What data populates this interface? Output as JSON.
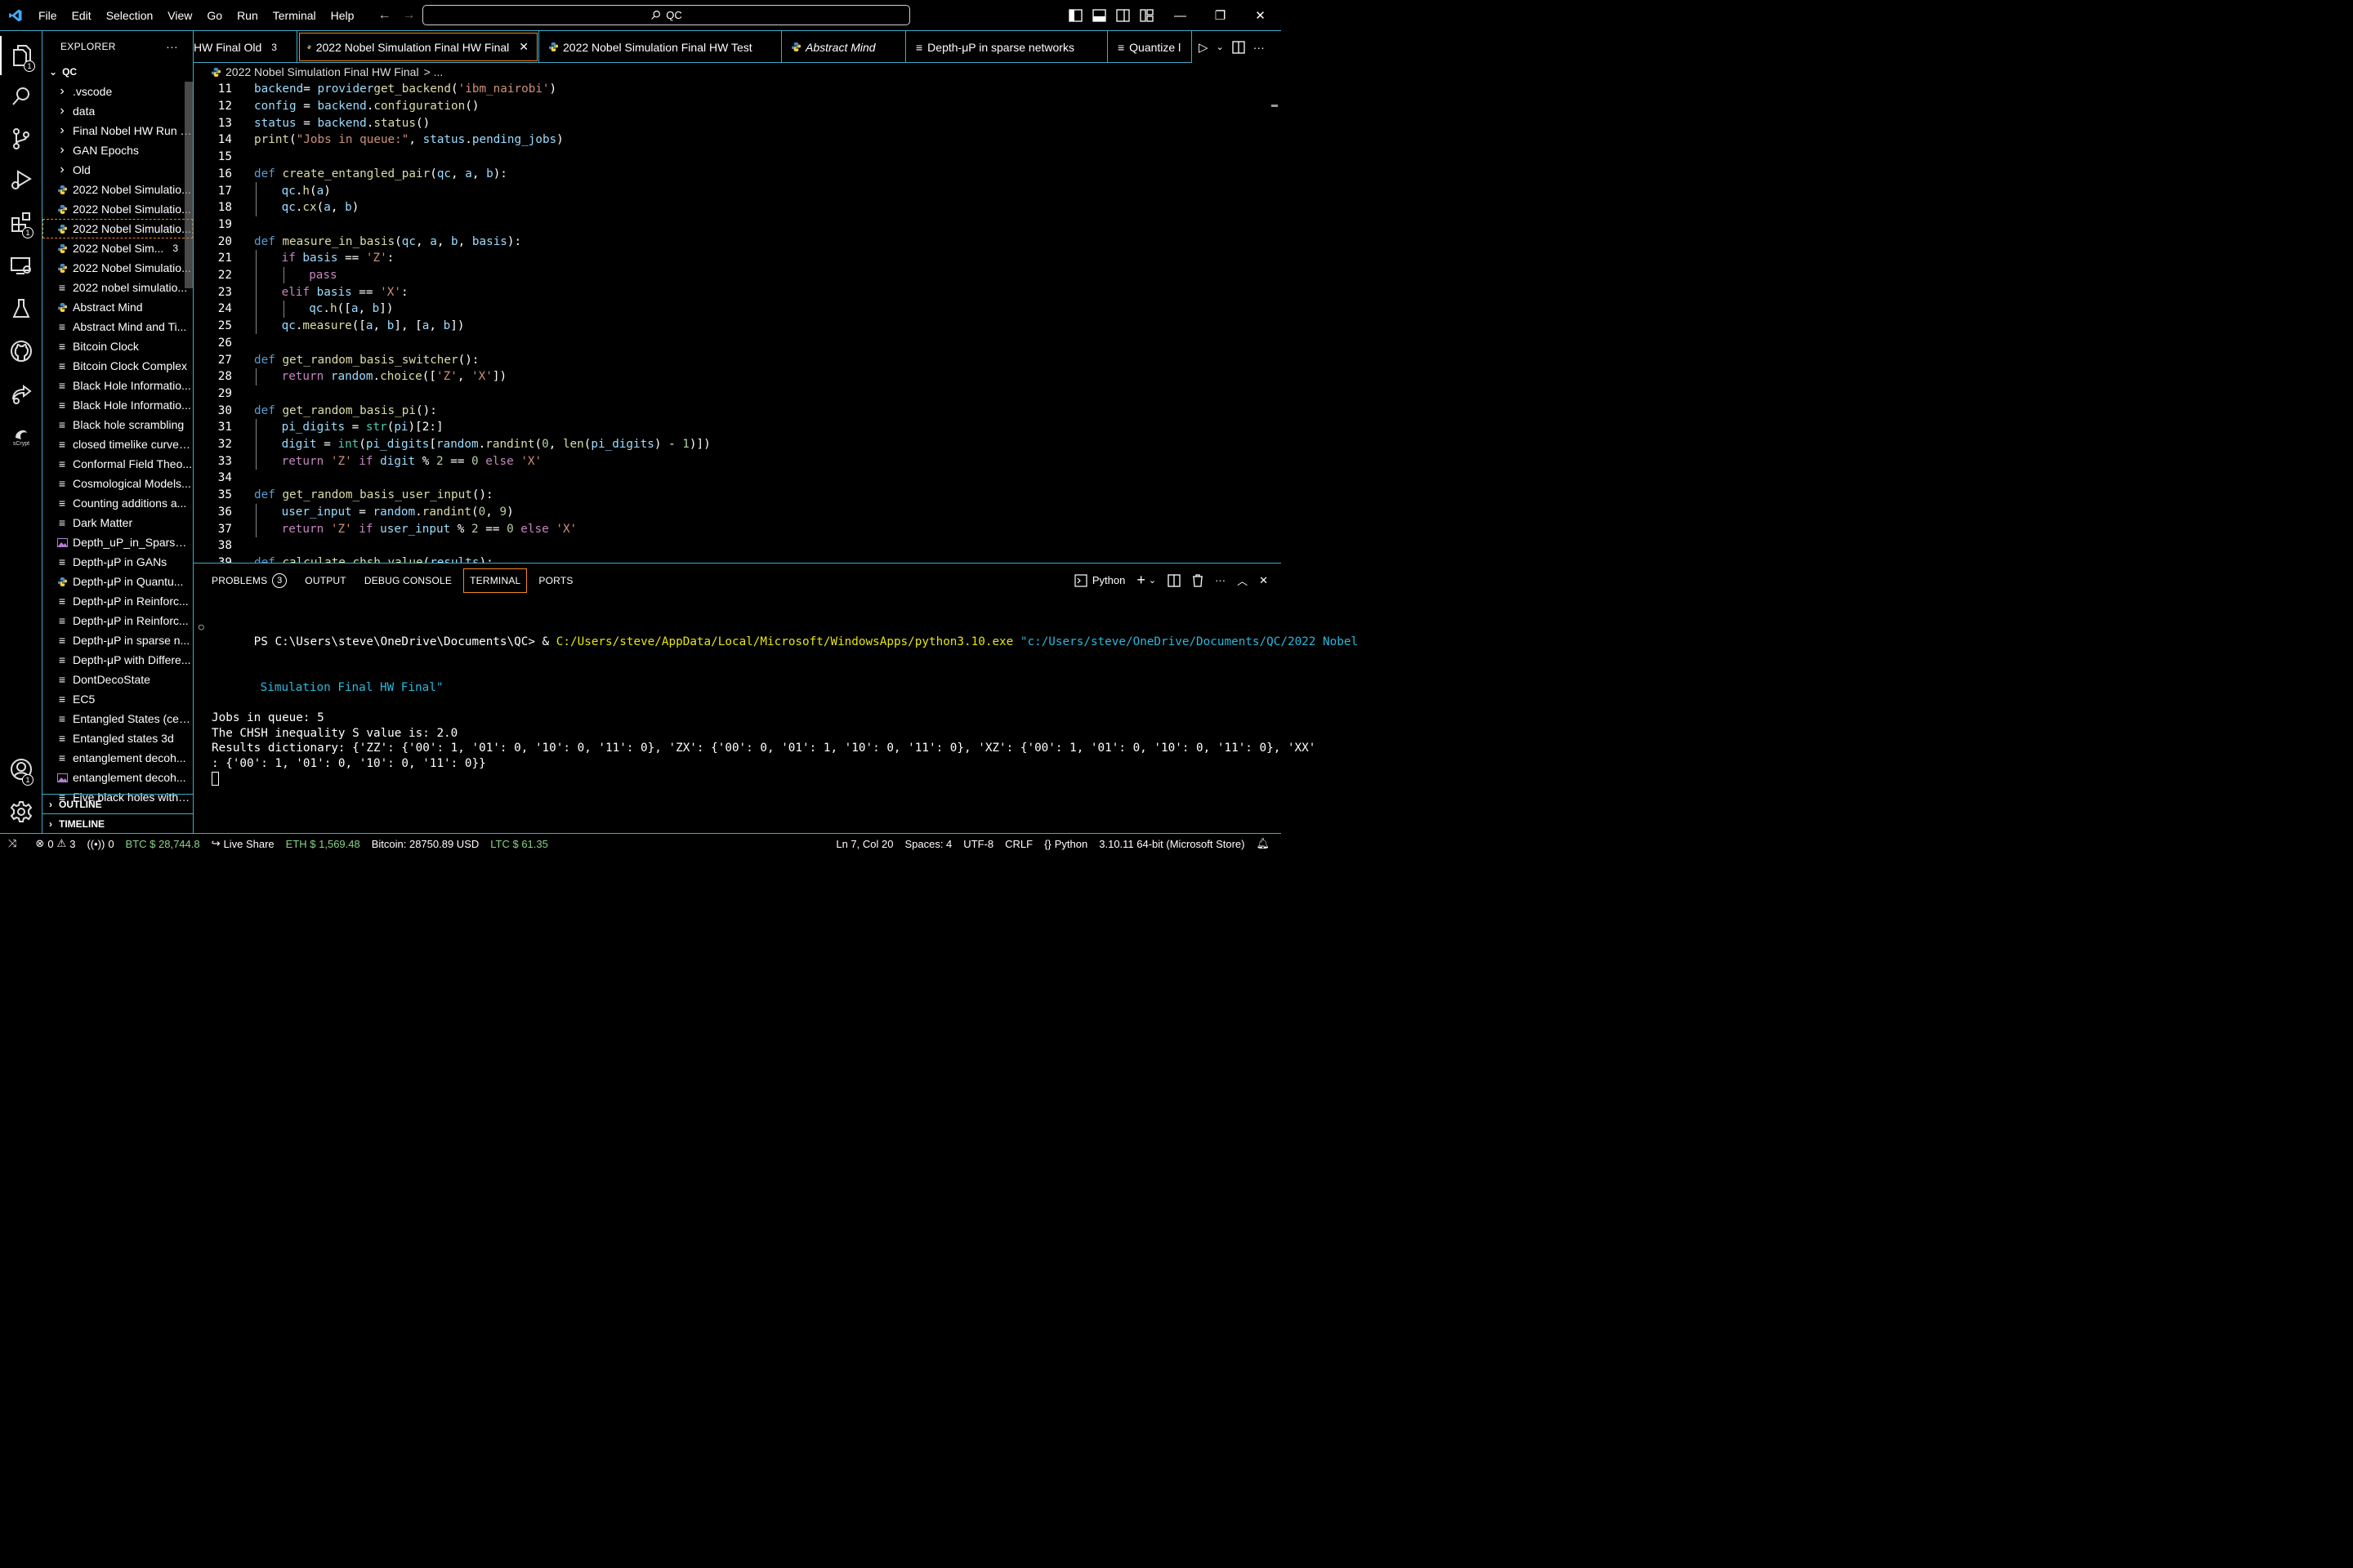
{
  "titlebar": {
    "menu": [
      "File",
      "Edit",
      "Selection",
      "View",
      "Go",
      "Run",
      "Terminal",
      "Help"
    ],
    "search": "QC"
  },
  "activitybar": {
    "explorer_badge": "1",
    "extensions_badge": "1",
    "accounts_badge": "1",
    "scrypt_label": "sCrypt"
  },
  "explorer": {
    "title": "EXPLORER",
    "more": "···",
    "root": "QC",
    "items": [
      {
        "label": ".vscode",
        "type": "folder"
      },
      {
        "label": "data",
        "type": "folder"
      },
      {
        "label": "Final Nobel HW Run 10",
        "type": "folder"
      },
      {
        "label": "GAN Epochs",
        "type": "folder"
      },
      {
        "label": "Old",
        "type": "folder"
      },
      {
        "label": "2022 Nobel Simulatio...",
        "type": "py"
      },
      {
        "label": "2022 Nobel Simulatio...",
        "type": "py"
      },
      {
        "label": "2022 Nobel Simulatio...",
        "type": "py"
      },
      {
        "label": "2022 Nobel Sim...",
        "type": "py",
        "count": "3"
      },
      {
        "label": "2022 Nobel Simulatio...",
        "type": "py"
      },
      {
        "label": "2022 nobel simulatio...",
        "type": "txt"
      },
      {
        "label": "Abstract Mind",
        "type": "py"
      },
      {
        "label": "Abstract Mind and Ti...",
        "type": "txt"
      },
      {
        "label": "Bitcoin Clock",
        "type": "txt"
      },
      {
        "label": "Bitcoin Clock Complex",
        "type": "txt"
      },
      {
        "label": "Black Hole Informatio...",
        "type": "txt"
      },
      {
        "label": "Black Hole Informatio...",
        "type": "txt"
      },
      {
        "label": "Black hole scrambling",
        "type": "txt"
      },
      {
        "label": "closed timelike curves...",
        "type": "txt"
      },
      {
        "label": "Conformal Field Theo...",
        "type": "txt"
      },
      {
        "label": "Cosmological Models...",
        "type": "txt"
      },
      {
        "label": "Counting additions a...",
        "type": "txt"
      },
      {
        "label": "Dark Matter",
        "type": "txt"
      },
      {
        "label": "Depth_uP_in_Sparse_...",
        "type": "img"
      },
      {
        "label": "Depth-μP in GANs",
        "type": "txt"
      },
      {
        "label": "Depth-μP in Quantu...",
        "type": "py"
      },
      {
        "label": "Depth-μP in Reinforc...",
        "type": "txt"
      },
      {
        "label": "Depth-μP in Reinforc...",
        "type": "txt"
      },
      {
        "label": "Depth-μP in sparse n...",
        "type": "txt"
      },
      {
        "label": "Depth-μP with Differe...",
        "type": "txt"
      },
      {
        "label": "DontDecoState",
        "type": "txt"
      },
      {
        "label": "EC5",
        "type": "txt"
      },
      {
        "label": "Entangled States (cen...",
        "type": "txt"
      },
      {
        "label": "Entangled states 3d",
        "type": "txt"
      },
      {
        "label": "entanglement decoh...",
        "type": "txt"
      },
      {
        "label": "entanglement decoh...",
        "type": "img"
      },
      {
        "label": "Five black holes with h...",
        "type": "txt"
      }
    ],
    "outline": "OUTLINE",
    "timeline": "TIMELINE"
  },
  "tabs": [
    {
      "label": "HW Final Old",
      "count": "3",
      "icon": "py",
      "italic": false
    },
    {
      "label": "2022 Nobel Simulation Final HW Final",
      "icon": "py",
      "active": true,
      "italic": false
    },
    {
      "label": "2022 Nobel Simulation Final HW Test",
      "icon": "py",
      "italic": false
    },
    {
      "label": "Abstract Mind",
      "icon": "py",
      "italic": true
    },
    {
      "label": "Depth-μP in sparse networks",
      "icon": "txt",
      "italic": false
    },
    {
      "label": "Quantize l",
      "icon": "txt",
      "italic": false
    }
  ],
  "breadcrumb": {
    "file": "2022 Nobel Simulation Final HW Final",
    "more": "> ..."
  },
  "code": [
    {
      "n": "11",
      "t": ""
    },
    {
      "n": "12",
      "t": ""
    },
    {
      "n": "13",
      "t": ""
    },
    {
      "n": "14",
      "t": ""
    },
    {
      "n": "15",
      "t": ""
    },
    {
      "n": "16",
      "t": ""
    },
    {
      "n": "17",
      "t": ""
    },
    {
      "n": "18",
      "t": ""
    },
    {
      "n": "19",
      "t": ""
    },
    {
      "n": "20",
      "t": ""
    },
    {
      "n": "21",
      "t": ""
    },
    {
      "n": "22",
      "t": ""
    },
    {
      "n": "23",
      "t": ""
    },
    {
      "n": "24",
      "t": ""
    },
    {
      "n": "25",
      "t": ""
    },
    {
      "n": "26",
      "t": ""
    },
    {
      "n": "27",
      "t": ""
    },
    {
      "n": "28",
      "t": ""
    },
    {
      "n": "29",
      "t": ""
    },
    {
      "n": "30",
      "t": ""
    },
    {
      "n": "31",
      "t": ""
    },
    {
      "n": "32",
      "t": ""
    },
    {
      "n": "33",
      "t": ""
    },
    {
      "n": "34",
      "t": ""
    },
    {
      "n": "35",
      "t": ""
    },
    {
      "n": "36",
      "t": ""
    },
    {
      "n": "37",
      "t": ""
    },
    {
      "n": "38",
      "t": ""
    },
    {
      "n": "39",
      "t": ""
    }
  ],
  "code_tokens": [
    [
      [
        "vr",
        "backend"
      ],
      [
        "",
        "="
      ],
      [
        "vr",
        " provider"
      ],
      [
        "",
        ""
      ],
      [
        "fn",
        "get_backend"
      ],
      [
        "",
        "("
      ],
      [
        "str",
        "'ibm_nairobi'"
      ],
      [
        "",
        ")"
      ]
    ],
    [
      [
        "vr",
        "config"
      ],
      [
        "",
        " = "
      ],
      [
        "vr",
        "backend"
      ],
      [
        "",
        "."
      ],
      [
        "fn",
        "configuration"
      ],
      [
        "",
        "()"
      ]
    ],
    [
      [
        "vr",
        "status"
      ],
      [
        "",
        " = "
      ],
      [
        "vr",
        "backend"
      ],
      [
        "",
        "."
      ],
      [
        "fn",
        "status"
      ],
      [
        "",
        "()"
      ]
    ],
    [
      [
        "fn",
        "print"
      ],
      [
        "",
        "("
      ],
      [
        "str",
        "\"Jobs in queue:\""
      ],
      [
        "",
        ", "
      ],
      [
        "vr",
        "status"
      ],
      [
        "",
        "."
      ],
      [
        "vr",
        "pending_jobs"
      ],
      [
        "",
        ")"
      ]
    ],
    [],
    [
      [
        "kw",
        "def"
      ],
      [
        "",
        " "
      ],
      [
        "fn",
        "create_entangled_pair"
      ],
      [
        "",
        "("
      ],
      [
        "vr",
        "qc"
      ],
      [
        "",
        ", "
      ],
      [
        "vr",
        "a"
      ],
      [
        "",
        ", "
      ],
      [
        "vr",
        "b"
      ],
      [
        "",
        "):"
      ]
    ],
    [
      [
        "",
        ""
      ],
      [
        "vr",
        "qc"
      ],
      [
        "",
        "."
      ],
      [
        "fn",
        "h"
      ],
      [
        "",
        "("
      ],
      [
        "vr",
        "a"
      ],
      [
        "",
        ")"
      ]
    ],
    [
      [
        "",
        ""
      ],
      [
        "vr",
        "qc"
      ],
      [
        "",
        "."
      ],
      [
        "fn",
        "cx"
      ],
      [
        "",
        "("
      ],
      [
        "vr",
        "a"
      ],
      [
        "",
        ", "
      ],
      [
        "vr",
        "b"
      ],
      [
        "",
        ")"
      ]
    ],
    [],
    [
      [
        "kw",
        "def"
      ],
      [
        "",
        " "
      ],
      [
        "fn",
        "measure_in_basis"
      ],
      [
        "",
        "("
      ],
      [
        "vr",
        "qc"
      ],
      [
        "",
        ", "
      ],
      [
        "vr",
        "a"
      ],
      [
        "",
        ", "
      ],
      [
        "vr",
        "b"
      ],
      [
        "",
        ", "
      ],
      [
        "vr",
        "basis"
      ],
      [
        "",
        "):"
      ]
    ],
    [
      [
        "ctl",
        "if"
      ],
      [
        "",
        " "
      ],
      [
        "vr",
        "basis"
      ],
      [
        "",
        " == "
      ],
      [
        "str",
        "'Z'"
      ],
      [
        "",
        ":"
      ]
    ],
    [
      [
        "ctl",
        "pass"
      ]
    ],
    [
      [
        "ctl",
        "elif"
      ],
      [
        "",
        " "
      ],
      [
        "vr",
        "basis"
      ],
      [
        "",
        " == "
      ],
      [
        "str",
        "'X'"
      ],
      [
        "",
        ":"
      ]
    ],
    [
      [
        "vr",
        "qc"
      ],
      [
        "",
        "."
      ],
      [
        "fn",
        "h"
      ],
      [
        "",
        "(["
      ],
      [
        "vr",
        "a"
      ],
      [
        "",
        ", "
      ],
      [
        "vr",
        "b"
      ],
      [
        "",
        "])"
      ]
    ],
    [
      [
        "vr",
        "qc"
      ],
      [
        "",
        "."
      ],
      [
        "fn",
        "measure"
      ],
      [
        "",
        "(["
      ],
      [
        "vr",
        "a"
      ],
      [
        "",
        ", "
      ],
      [
        "vr",
        "b"
      ],
      [
        "",
        "], ["
      ],
      [
        "vr",
        "a"
      ],
      [
        "",
        ", "
      ],
      [
        "vr",
        "b"
      ],
      [
        "",
        "])"
      ]
    ],
    [],
    [
      [
        "kw",
        "def"
      ],
      [
        "",
        " "
      ],
      [
        "fn",
        "get_random_basis_switcher"
      ],
      [
        "",
        "():"
      ]
    ],
    [
      [
        "ctl",
        "return"
      ],
      [
        "",
        " "
      ],
      [
        "vr",
        "random"
      ],
      [
        "",
        "."
      ],
      [
        "fn",
        "choice"
      ],
      [
        "",
        "(["
      ],
      [
        "str",
        "'Z'"
      ],
      [
        "",
        ", "
      ],
      [
        "str",
        "'X'"
      ],
      [
        "",
        "])"
      ]
    ],
    [],
    [
      [
        "kw",
        "def"
      ],
      [
        "",
        " "
      ],
      [
        "fn",
        "get_random_basis_pi"
      ],
      [
        "",
        "():"
      ]
    ],
    [
      [
        "vr",
        "pi_digits"
      ],
      [
        "",
        " = "
      ],
      [
        "bi",
        "str"
      ],
      [
        "",
        "("
      ],
      [
        "vr",
        "pi"
      ],
      [
        "",
        ")[2:]"
      ]
    ],
    [
      [
        "vr",
        "digit"
      ],
      [
        "",
        " = "
      ],
      [
        "bi",
        "int"
      ],
      [
        "",
        "("
      ],
      [
        "vr",
        "pi_digits"
      ],
      [
        "",
        "["
      ],
      [
        "vr",
        "random"
      ],
      [
        "",
        "."
      ],
      [
        "fn",
        "randint"
      ],
      [
        "",
        "("
      ],
      [
        "num",
        "0"
      ],
      [
        "",
        ", "
      ],
      [
        "fn",
        "len"
      ],
      [
        "",
        "("
      ],
      [
        "vr",
        "pi_digits"
      ],
      [
        "",
        ") - "
      ],
      [
        "num",
        "1"
      ],
      [
        "",
        ")])"
      ]
    ],
    [
      [
        "ctl",
        "return"
      ],
      [
        "",
        " "
      ],
      [
        "str",
        "'Z'"
      ],
      [
        "",
        " "
      ],
      [
        "ctl",
        "if"
      ],
      [
        "",
        " "
      ],
      [
        "vr",
        "digit"
      ],
      [
        "",
        " % "
      ],
      [
        "num",
        "2"
      ],
      [
        "",
        " == "
      ],
      [
        "num",
        "0"
      ],
      [
        "",
        " "
      ],
      [
        "ctl",
        "else"
      ],
      [
        "",
        " "
      ],
      [
        "str",
        "'X'"
      ]
    ],
    [],
    [
      [
        "kw",
        "def"
      ],
      [
        "",
        " "
      ],
      [
        "fn",
        "get_random_basis_user_input"
      ],
      [
        "",
        "():"
      ]
    ],
    [
      [
        "vr",
        "user_input"
      ],
      [
        "",
        " = "
      ],
      [
        "vr",
        "random"
      ],
      [
        "",
        "."
      ],
      [
        "fn",
        "randint"
      ],
      [
        "",
        "("
      ],
      [
        "num",
        "0"
      ],
      [
        "",
        ", "
      ],
      [
        "num",
        "9"
      ],
      [
        "",
        ")"
      ]
    ],
    [
      [
        "ctl",
        "return"
      ],
      [
        "",
        " "
      ],
      [
        "str",
        "'Z'"
      ],
      [
        "",
        " "
      ],
      [
        "ctl",
        "if"
      ],
      [
        "",
        " "
      ],
      [
        "vr",
        "user_input"
      ],
      [
        "",
        " % "
      ],
      [
        "num",
        "2"
      ],
      [
        "",
        " == "
      ],
      [
        "num",
        "0"
      ],
      [
        "",
        " "
      ],
      [
        "ctl",
        "else"
      ],
      [
        "",
        " "
      ],
      [
        "str",
        "'X'"
      ]
    ],
    [],
    [
      [
        "kw",
        "def"
      ],
      [
        "",
        " "
      ],
      [
        "fn",
        "calculate_chsh_value"
      ],
      [
        "",
        "("
      ],
      [
        "vr",
        "results"
      ],
      [
        "",
        "):"
      ]
    ]
  ],
  "code_indent": [
    0,
    0,
    0,
    0,
    0,
    0,
    1,
    1,
    0,
    0,
    1,
    2,
    1,
    2,
    1,
    0,
    0,
    1,
    0,
    0,
    1,
    1,
    1,
    0,
    0,
    1,
    1,
    0,
    0
  ],
  "panel": {
    "tabs": [
      "PROBLEMS",
      "OUTPUT",
      "DEBUG CONSOLE",
      "TERMINAL",
      "PORTS"
    ],
    "problems_count": "3",
    "shell": "Python"
  },
  "terminal": {
    "prompt": "PS C:\\Users\\steve\\OneDrive\\Documents\\QC> & ",
    "exe": "C:/Users/steve/AppData/Local/Microsoft/WindowsApps/python3.10.exe",
    "arg1": " \"c:/Users/steve/OneDrive/Documents/QC/2022 Nobel",
    "arg2": "Simulation Final HW Final\"",
    "out1": "Jobs in queue: 5",
    "out2": "The CHSH inequality S value is: 2.0",
    "out3": "Results dictionary: {'ZZ': {'00': 1, '01': 0, '10': 0, '11': 0}, 'ZX': {'00': 0, '01': 1, '10': 0, '11': 0}, 'XZ': {'00': 1, '01': 0, '10': 0, '11': 0}, 'XX'",
    "out4": ": {'00': 1, '01': 0, '10': 0, '11': 0}}"
  },
  "statusbar": {
    "errors": "0",
    "warnings": "3",
    "ports": "0",
    "btc": "BTC $ 28,744.8",
    "liveshare": "Live Share",
    "eth": "ETH $ 1,569.48",
    "bitcoin": "Bitcoin: 28750.89 USD",
    "ltc": "LTC $ 61.35",
    "position": "Ln 7, Col 20",
    "spaces": "Spaces: 4",
    "encoding": "UTF-8",
    "eol": "CRLF",
    "language": "Python",
    "interpreter": "3.10.11 64-bit (Microsoft Store)"
  },
  "colors": {
    "border": "#3fa9c6",
    "focus": "#f38518",
    "keyword": "#569cd6",
    "function": "#dcdcaa",
    "string": "#ce9178",
    "variable": "#9cdcfe",
    "control": "#c586c0",
    "number": "#b5cea8"
  }
}
